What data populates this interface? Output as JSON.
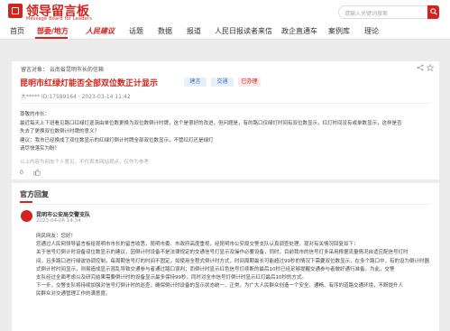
{
  "brand": {
    "title": "领导留言板",
    "subtitle": "Message Board for Leaders",
    "accent": "#d3231e"
  },
  "search": {
    "placeholder": "请输入关键词搜索"
  },
  "nav": {
    "items": [
      "首页",
      "部委/地方",
      "人民建议",
      "话题",
      "数据",
      "报道",
      "人民日报读者来信",
      "政企直通车",
      "案例库",
      "理论"
    ]
  },
  "message": {
    "target": "留言对象：  云南省昆明市长的信箱",
    "title": "昆明市红绿灯能否全部双位数正计显示",
    "tags": [
      "建言",
      "交通",
      "已办理"
    ],
    "meta": "大*****   ID:17589164 · 2023-03-14 11:42",
    "body": [
      "尊敬的市长：",
      "    最近每天上下班看见路口红绿灯逐渐由单位数更换为双位数倒计时牌，这个是很好的改进，但问题是，有的路口仅绿灯时间有双位数显示，红灯时间没有或单数显示，这样是否",
      "失去了更换双位数倒计时牌的意义？",
      "    建议：我市已经换成了双位数显示的红绿灯倒计时牌全部双位数显示，不管红灯还是绿灯",
      "    请尽快落实为盼！"
    ],
    "note": "以上内容为网友个人意见，不代表本网站观点，仅作为参考",
    "likes": "0"
  },
  "reply": {
    "section_title": "官方回复",
    "org": "昆明市公安局交警支队",
    "date": "2023-04-06 14:34",
    "body": [
      "网民网友：您好！",
      "    您通过人民网领导留言板给昆明市市长的留言收悉，昆明市委、市政府高度重视，经昆明市公安局交警支队认真调查处理，现对有关情况回复如下：",
      "    关于信号灯倒计时设备双位数显示的建议，因倒计时设备不是法律规定的交通信号灯显示及操作必要设备，同时，目前我市的信号灯多采用根据流量情况自适应配信号灯时",
      "间，且多路口进行绿波协调控制，每周期信号灯的时间不固定，如使用全程式倒计时方式，时间周期最长可能超过99秒的情况下需要双位数显示，在多个路口中，有的设为倒计时器",
      "式倒计时时间显示，则易造成显示混乱导致交通参与者通过路口误判；而倒计时显示红色信号灯续断的最后10秒已经足够提醒交通参与者做好通行准备。为此，交警",
      "支队经过全面考虑以及研究结果需要倒计时的设备显示最多保持99秒，同时对全市信号灯倒计时显示红灯最后10秒的方式。",
      "    下一步，交警支队将持续加强对信号灯倒计时的巡查，确保倒计时设备的显示状态统一、正常，为广大人民群众创造一个安全、通畅、有序的道路交通环境，不断提升人",
      "民群众对交通管理工作的满意度。"
    ]
  }
}
